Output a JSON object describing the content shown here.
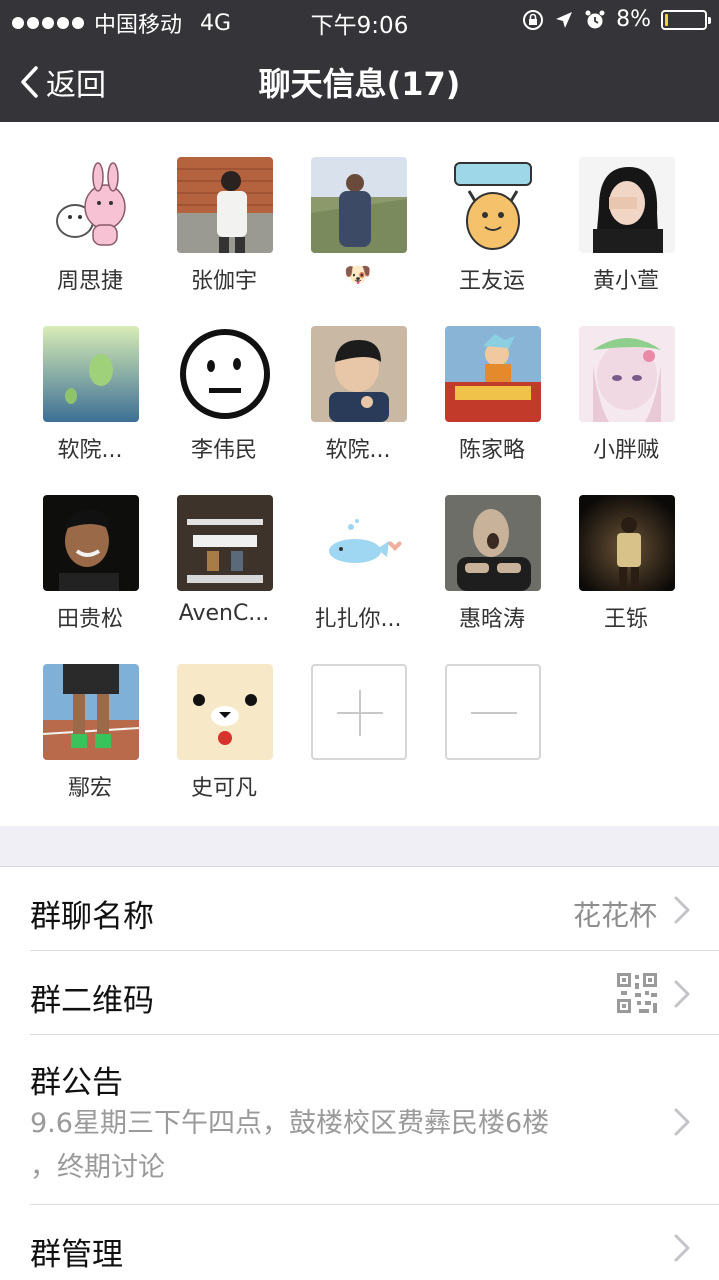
{
  "status_bar": {
    "carrier": "中国移动",
    "network": "4G",
    "time": "下午9:06",
    "battery_percent": "8%",
    "battery_level": 0.08,
    "icons": [
      "signal-dots-icon",
      "orientation-lock-icon",
      "location-icon",
      "alarm-icon",
      "battery-icon"
    ]
  },
  "nav": {
    "back_label": "返回",
    "title": "聊天信息(17)"
  },
  "members": [
    {
      "name": "周思捷"
    },
    {
      "name": "张伽宇"
    },
    {
      "name": "🐶"
    },
    {
      "name": "王友运"
    },
    {
      "name": "黄小萱"
    },
    {
      "name": "软院..."
    },
    {
      "name": "李伟民"
    },
    {
      "name": "软院..."
    },
    {
      "name": "陈家略"
    },
    {
      "name": "小胖贼"
    },
    {
      "name": "田贵松"
    },
    {
      "name": "AvenC..."
    },
    {
      "name": "扎扎你..."
    },
    {
      "name": "惠晗涛"
    },
    {
      "name": "王铄"
    },
    {
      "name": "鄢宏"
    },
    {
      "name": "史可凡"
    }
  ],
  "member_actions": {
    "add_icon": "plus-icon",
    "remove_icon": "minus-icon"
  },
  "settings": {
    "group_name_label": "群聊名称",
    "group_name_value": "花花杯",
    "qr_label": "群二维码",
    "notice_label": "群公告",
    "notice_line1": "9.6星期三下午四点，鼓楼校区费彝民楼6楼",
    "notice_line2": "，终期讨论",
    "manage_label": "群管理"
  },
  "colors": {
    "topbar": "#353439",
    "page_bg": "#f0eff5",
    "secondary_text": "#8e8e8e"
  }
}
